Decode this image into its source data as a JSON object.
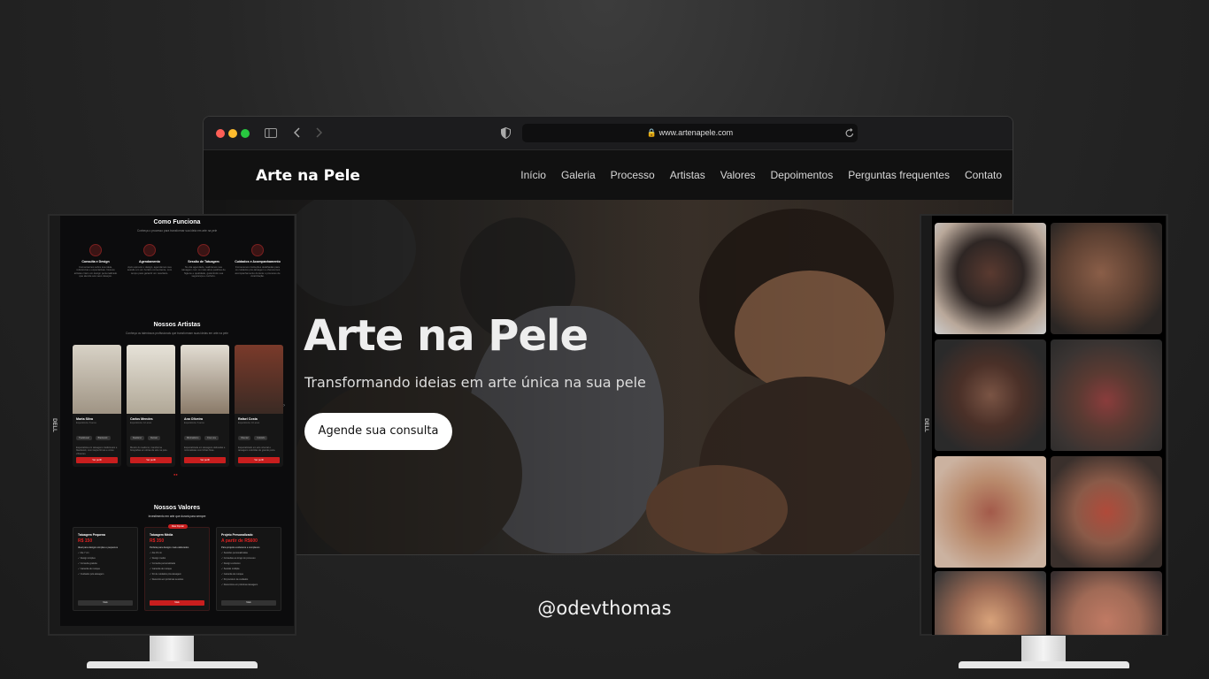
{
  "browser": {
    "url": "www.artenapele.com"
  },
  "site": {
    "brand": "Arte na Pele",
    "nav": [
      "Início",
      "Galeria",
      "Processo",
      "Artistas",
      "Valores",
      "Depoimentos",
      "Perguntas frequentes",
      "Contato"
    ],
    "hero": {
      "title": "Arte na Pele",
      "subtitle": "Transformando ideias em arte única na sua pele",
      "cta": "Agende sua consulta"
    }
  },
  "left_monitor": {
    "brand_logo": "DELL",
    "how_it_works": {
      "title": "Como Funciona",
      "subtitle": "Conheça o processo para transformar sua ideia em arte na pele",
      "steps": [
        {
          "title": "Consulta e Design",
          "desc": "Conversamos sobre sua ideia, referências e expectativas. Nossos artistas criam um design personalizado que atende aos seus desejos."
        },
        {
          "title": "Agendamento",
          "desc": "Após aprovar o design, agendamos sua sessão em um horário conveniente, com tempo para garantir um resultado."
        },
        {
          "title": "Sessão de Tatuagem",
          "desc": "No dia agendado, realizamos sua tatuagem com os mais altos padrões de higiene e qualidade, garantindo sua segurança e conforto."
        },
        {
          "title": "Cuidados e Acompanhamento",
          "desc": "Fornecemos instruções detalhadas para os cuidados pós-tatuagem e oferecemos acompanhamento durante o processo de cicatrização."
        }
      ]
    },
    "artists": {
      "title": "Nossos Artistas",
      "subtitle": "Conheça os talentosos profissionais que transformam suas ideias em arte na pele",
      "cards": [
        {
          "name": "Marta Silva",
          "meta": "Experiência: 8 anos",
          "tags": [
            "Tradicional",
            "Blackwork"
          ],
          "desc": "Especialista em tatuagens tradicionais e blackwork, com traços firmes e cores vibrantes.",
          "button": "Ver perfil"
        },
        {
          "name": "Carlos Mendes",
          "meta": "Experiência: 12 anos",
          "tags": [
            "Realismo",
            "Retrato"
          ],
          "desc": "Mestre do realismo, transforma fotografias em obras de arte na pele.",
          "button": "Ver perfil"
        },
        {
          "name": "Ana Oliveira",
          "meta": "Experiência: 6 anos",
          "tags": [
            "Minimalismo",
            "Fine Line"
          ],
          "desc": "Especializada em tatuagens delicadas e minimalistas com linhas finas.",
          "button": "Ver perfil"
        },
        {
          "name": "Rafael Costa",
          "meta": "Experiência: 10 anos",
          "tags": [
            "Oriental",
            "Colorido"
          ],
          "desc": "Especializado em arte oriental e tatuagens coloridas de grande porte.",
          "button": "Ver perfil"
        }
      ]
    },
    "values": {
      "title": "Nossos Valores",
      "subtitle": "Investimento em arte que durará para sempre",
      "popular_badge": "Mais Popular",
      "plans": [
        {
          "title": "Tatuagem Pequena",
          "price": "R$ 150",
          "desc": "Ideal para designs simples e pequenos",
          "items": [
            "Até 7 cm",
            "Design simples",
            "Consulta gratuita",
            "Garantia de retoque",
            "Cuidados pós-tatuagem"
          ],
          "button": "Mais"
        },
        {
          "title": "Tatuagem Média",
          "price": "R$ 350",
          "desc": "Perfeita para designs mais elaborados",
          "items": [
            "Até 15 cm",
            "Design médio",
            "Consulta personalizada",
            "Garantia de retoque",
            "Kit de cuidados pós-tatuagem",
            "Desconto em próximas sessões"
          ],
          "button": "Mais"
        },
        {
          "title": "Projeto Personalizado",
          "price": "A partir de R$600",
          "desc": "Para projetos exclusivos e complexos",
          "items": [
            "Sessões personalizadas",
            "Consultas ao longo do processo",
            "Design exclusivo",
            "Sessão múltipla",
            "Garantia de retoque",
            "Kit premium de cuidados",
            "Descontos em próximas tatuagens"
          ],
          "button": "Mais"
        }
      ]
    }
  },
  "right_monitor": {
    "brand_logo": "DELL",
    "gallery_count": 8
  },
  "credit": "@odevthomas"
}
